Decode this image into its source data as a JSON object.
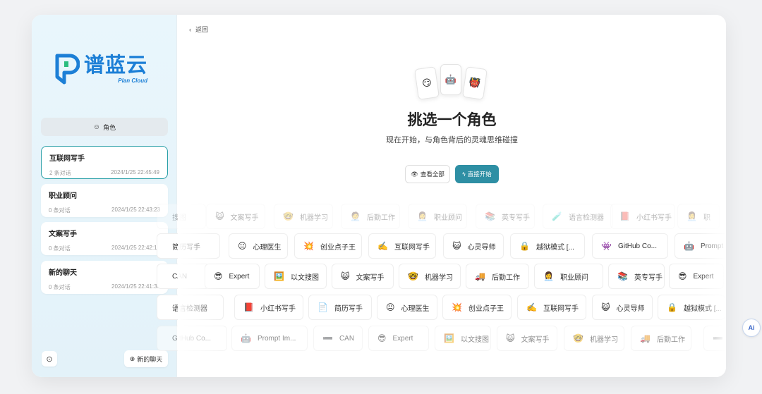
{
  "brand": {
    "name_cn": "谱蓝云",
    "name_en": "Plan Cloud",
    "color": "#1c7fd6"
  },
  "sidebar": {
    "role_tab": {
      "icon": "robot-icon",
      "glyph": "☺",
      "label": "角色"
    },
    "conversations": [
      {
        "title": "互联网写手",
        "count": "2 条对话",
        "time": "2024/1/25 22:45:49",
        "active": true
      },
      {
        "title": "职业顾问",
        "count": "0 条对话",
        "time": "2024/1/25 22:43:23",
        "active": false
      },
      {
        "title": "文案写手",
        "count": "0 条对话",
        "time": "2024/1/25 22:42:17",
        "active": false
      },
      {
        "title": "新的聊天",
        "count": "0 条对话",
        "time": "2024/1/25 22:41:38",
        "active": false
      }
    ],
    "settings_glyph": "⊙",
    "new_chat": {
      "glyph": "⊕",
      "label": "新的聊天"
    }
  },
  "main": {
    "back": {
      "glyph": "‹",
      "label": "返回"
    },
    "cards": [
      "😏",
      "🤖",
      "👹"
    ],
    "title": "挑选一个角色",
    "subtitle": "现在开始，与角色背后的灵魂思维碰撞",
    "btn_all": {
      "glyph": "👁",
      "label": "查看全部"
    },
    "btn_start": {
      "glyph": "ϟ",
      "label": "直接开始"
    },
    "rows": [
      {
        "style": "row-faint",
        "items": [
          {
            "e": "",
            "t": "搜图"
          },
          {
            "e": "😺",
            "t": "文案写手"
          },
          {
            "e": "🤓",
            "t": "机器学习"
          },
          {
            "e": "🧑‍💼",
            "t": "后勤工作"
          },
          {
            "e": "👩‍💼",
            "t": "职业顾问"
          },
          {
            "e": "📚",
            "t": "英专写手"
          },
          {
            "e": "🧪",
            "t": "语言检测器"
          },
          {
            "e": "📕",
            "t": "小红书写手"
          },
          {
            "e": "👩‍💼",
            "t": "职"
          }
        ]
      },
      {
        "style": "",
        "items": [
          {
            "e": "",
            "t": "简历写手"
          },
          {
            "e": "😐",
            "t": "心理医生"
          },
          {
            "e": "💥",
            "t": "创业点子王"
          },
          {
            "e": "✍️",
            "t": "互联网写手"
          },
          {
            "e": "😺",
            "t": "心灵导师"
          },
          {
            "e": "🔒",
            "t": "越狱模式 [..."
          },
          {
            "e": "👾",
            "t": "GitHub Co..."
          },
          {
            "e": "🤖",
            "t": "Prompt"
          }
        ]
      },
      {
        "style": "",
        "items": [
          {
            "e": "",
            "t": "CAN"
          },
          {
            "e": "😎",
            "t": "Expert"
          },
          {
            "e": "🖼️",
            "t": "以文搜图"
          },
          {
            "e": "😺",
            "t": "文案写手"
          },
          {
            "e": "🤓",
            "t": "机器学习"
          },
          {
            "e": "🚚",
            "t": "后勤工作"
          },
          {
            "e": "👩‍💼",
            "t": "职业顾问"
          },
          {
            "e": "📚",
            "t": "英专写手"
          },
          {
            "e": "😎",
            "t": "Expert"
          }
        ]
      },
      {
        "style": "",
        "items": [
          {
            "e": "",
            "t": "语言检测器"
          },
          {
            "e": "📕",
            "t": "小红书写手"
          },
          {
            "e": "📄",
            "t": "简历写手"
          },
          {
            "e": "😐",
            "t": "心理医生"
          },
          {
            "e": "💥",
            "t": "创业点子王"
          },
          {
            "e": "✍️",
            "t": "互联网写手"
          },
          {
            "e": "😺",
            "t": "心灵导师"
          },
          {
            "e": "🔒",
            "t": "越狱模式 [..."
          }
        ]
      },
      {
        "style": "row-mid",
        "items": [
          {
            "e": "",
            "t": "GitHub Co..."
          },
          {
            "e": "🤖",
            "t": "Prompt Im..."
          },
          {
            "e": "➖",
            "t": "CAN"
          },
          {
            "e": "😎",
            "t": "Expert"
          },
          {
            "e": "🖼️",
            "t": "以文搜图"
          },
          {
            "e": "😺",
            "t": "文案写手"
          },
          {
            "e": "🤓",
            "t": "机器学习"
          },
          {
            "e": "🚚",
            "t": "后勤工作"
          },
          {
            "e": "➖",
            "t": ""
          }
        ]
      }
    ]
  },
  "ai_badge": "Ai"
}
